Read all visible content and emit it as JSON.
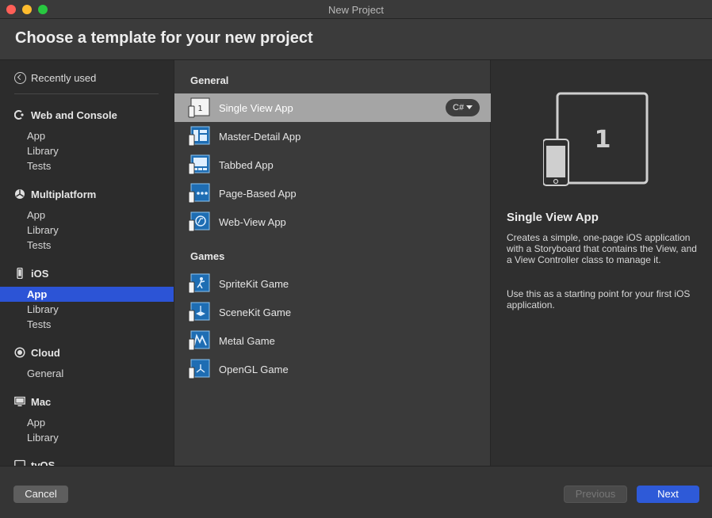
{
  "window": {
    "title": "New Project"
  },
  "header": {
    "title": "Choose a template for your new project"
  },
  "sidebar": {
    "recent": "Recently used",
    "categories": [
      {
        "label": "Web and Console",
        "icon": "web-console-icon",
        "items": [
          "App",
          "Library",
          "Tests"
        ]
      },
      {
        "label": "Multiplatform",
        "icon": "multiplatform-icon",
        "items": [
          "App",
          "Library",
          "Tests"
        ]
      },
      {
        "label": "iOS",
        "icon": "iphone-icon",
        "items": [
          "App",
          "Library",
          "Tests"
        ],
        "selected": "App"
      },
      {
        "label": "Cloud",
        "icon": "cloud-icon",
        "items": [
          "General"
        ]
      },
      {
        "label": "Mac",
        "icon": "monitor-icon",
        "items": [
          "App",
          "Library"
        ]
      },
      {
        "label": "tvOS",
        "icon": "tv-icon",
        "items": []
      }
    ]
  },
  "middle": {
    "sections": [
      {
        "heading": "General",
        "templates": [
          {
            "label": "Single View App",
            "icon": "single-view-app-icon",
            "selected": true
          },
          {
            "label": "Master-Detail App",
            "icon": "master-detail-app-icon"
          },
          {
            "label": "Tabbed App",
            "icon": "tabbed-app-icon"
          },
          {
            "label": "Page-Based App",
            "icon": "page-based-app-icon"
          },
          {
            "label": "Web-View App",
            "icon": "web-view-app-icon"
          }
        ]
      },
      {
        "heading": "Games",
        "templates": [
          {
            "label": "SpriteKit Game",
            "icon": "spritekit-game-icon"
          },
          {
            "label": "SceneKit Game",
            "icon": "scenekit-game-icon"
          },
          {
            "label": "Metal Game",
            "icon": "metal-game-icon"
          },
          {
            "label": "OpenGL Game",
            "icon": "opengl-game-icon"
          }
        ]
      }
    ],
    "language": "C#"
  },
  "detail": {
    "preview_number": "1",
    "title": "Single View App",
    "description": "Creates a simple, one-page iOS application with a Storyboard that contains the View, and a View Controller class to manage it.",
    "description2": "Use this as a starting point for your first iOS application."
  },
  "footer": {
    "cancel": "Cancel",
    "previous": "Previous",
    "next": "Next"
  },
  "colors": {
    "accent": "#2c54d6",
    "selection_row": "#a5a5a5",
    "next_button": "#2e5ad8"
  }
}
